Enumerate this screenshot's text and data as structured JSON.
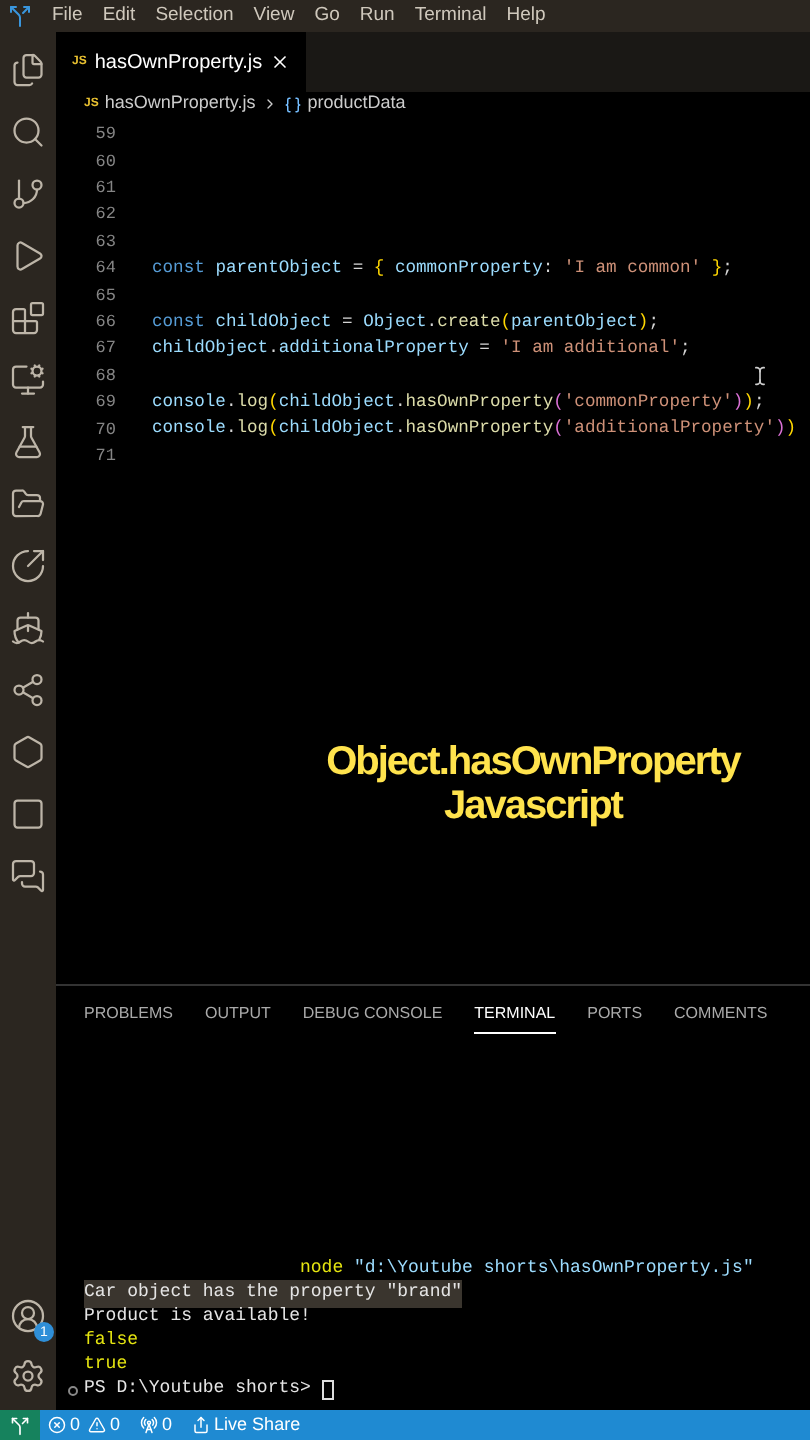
{
  "menu": [
    "File",
    "Edit",
    "Selection",
    "View",
    "Go",
    "Run",
    "Terminal",
    "Help"
  ],
  "tab": {
    "label": "hasOwnProperty.js",
    "badge": "JS",
    "selected": true
  },
  "breadcrumb": {
    "file": "hasOwnProperty.js",
    "badge": "JS",
    "symbol": "productData"
  },
  "code_lines": [
    {
      "number": "59"
    },
    {
      "number": "60"
    },
    {
      "number": "61"
    },
    {
      "number": "62"
    },
    {
      "number": "63"
    },
    {
      "number": "64",
      "tokens": [
        {
          "text": "const ",
          "kind": "kw"
        },
        {
          "text": "parentObject",
          "kind": "var"
        },
        {
          "text": " = ",
          "kind": "plain"
        },
        {
          "text": "{",
          "kind": "br"
        },
        {
          "text": " commonProperty",
          "kind": "var"
        },
        {
          "text": ": ",
          "kind": "plain"
        },
        {
          "text": "'I am common'",
          "kind": "str"
        },
        {
          "text": " }",
          "kind": "br"
        },
        {
          "text": ";",
          "kind": "plain"
        }
      ]
    },
    {
      "number": "65"
    },
    {
      "number": "66",
      "tokens": [
        {
          "text": "const ",
          "kind": "kw"
        },
        {
          "text": "childObject",
          "kind": "var"
        },
        {
          "text": " = ",
          "kind": "plain"
        },
        {
          "text": "Object",
          "kind": "var"
        },
        {
          "text": ".",
          "kind": "plain"
        },
        {
          "text": "create",
          "kind": "fn"
        },
        {
          "text": "(",
          "kind": "br"
        },
        {
          "text": "parentObject",
          "kind": "var"
        },
        {
          "text": ")",
          "kind": "br"
        },
        {
          "text": ";",
          "kind": "plain"
        }
      ]
    },
    {
      "number": "67",
      "tokens": [
        {
          "text": "childObject",
          "kind": "var"
        },
        {
          "text": ".",
          "kind": "plain"
        },
        {
          "text": "additionalProperty",
          "kind": "var"
        },
        {
          "text": " = ",
          "kind": "plain"
        },
        {
          "text": "'I am additional'",
          "kind": "str"
        },
        {
          "text": ";",
          "kind": "plain"
        }
      ]
    },
    {
      "number": "68"
    },
    {
      "number": "69",
      "tokens": [
        {
          "text": "console",
          "kind": "var"
        },
        {
          "text": ".",
          "kind": "plain"
        },
        {
          "text": "log",
          "kind": "fn"
        },
        {
          "text": "(",
          "kind": "br"
        },
        {
          "text": "childObject",
          "kind": "var"
        },
        {
          "text": ".",
          "kind": "plain"
        },
        {
          "text": "hasOwnProperty",
          "kind": "fn"
        },
        {
          "text": "(",
          "kind": "br2"
        },
        {
          "text": "'commonProperty'",
          "kind": "str"
        },
        {
          "text": ")",
          "kind": "br2"
        },
        {
          "text": ")",
          "kind": "br"
        },
        {
          "text": ";",
          "kind": "plain"
        }
      ]
    },
    {
      "number": "70",
      "tokens": [
        {
          "text": "console",
          "kind": "var"
        },
        {
          "text": ".",
          "kind": "plain"
        },
        {
          "text": "log",
          "kind": "fn"
        },
        {
          "text": "(",
          "kind": "br"
        },
        {
          "text": "childObject",
          "kind": "var"
        },
        {
          "text": ".",
          "kind": "plain"
        },
        {
          "text": "hasOwnProperty",
          "kind": "fn"
        },
        {
          "text": "(",
          "kind": "br2"
        },
        {
          "text": "'additionalProperty'",
          "kind": "str"
        },
        {
          "text": ")",
          "kind": "br2"
        },
        {
          "text": ")",
          "kind": "br"
        }
      ]
    },
    {
      "number": "71"
    }
  ],
  "caption": [
    "Object.hasOwnProperty",
    "Javascript"
  ],
  "panel_tabs": [
    {
      "label": "PROBLEMS",
      "selected": false
    },
    {
      "label": "OUTPUT",
      "selected": false
    },
    {
      "label": "DEBUG CONSOLE",
      "selected": false
    },
    {
      "label": "TERMINAL",
      "selected": true
    },
    {
      "label": "PORTS",
      "selected": false
    },
    {
      "label": "COMMENTS",
      "selected": false
    }
  ],
  "terminal_lines": [
    {
      "kind": "command",
      "tokens": [
        {
          "text": "node",
          "kind": "cmd"
        },
        {
          "text": " \"d:\\Youtube shorts\\hasOwnProperty.js\"",
          "kind": "arg"
        }
      ]
    },
    {
      "kind": "highlighted",
      "tokens": [
        {
          "text": "Car object has the property \"brand\"",
          "kind": "out"
        }
      ]
    },
    {
      "kind": "output",
      "tokens": [
        {
          "text": "Product is available!",
          "kind": "out"
        }
      ]
    },
    {
      "kind": "output",
      "tokens": [
        {
          "text": "false",
          "kind": "bool"
        }
      ]
    },
    {
      "kind": "output",
      "tokens": [
        {
          "text": "true",
          "kind": "bool"
        }
      ]
    },
    {
      "kind": "prompt",
      "tokens": [
        {
          "text": "PS D:\\Youtube shorts> ",
          "kind": "out"
        }
      ]
    }
  ],
  "account_badge": "1",
  "status": {
    "errors": "0",
    "warnings": "0",
    "ports": "0",
    "live_share": "Live Share"
  }
}
